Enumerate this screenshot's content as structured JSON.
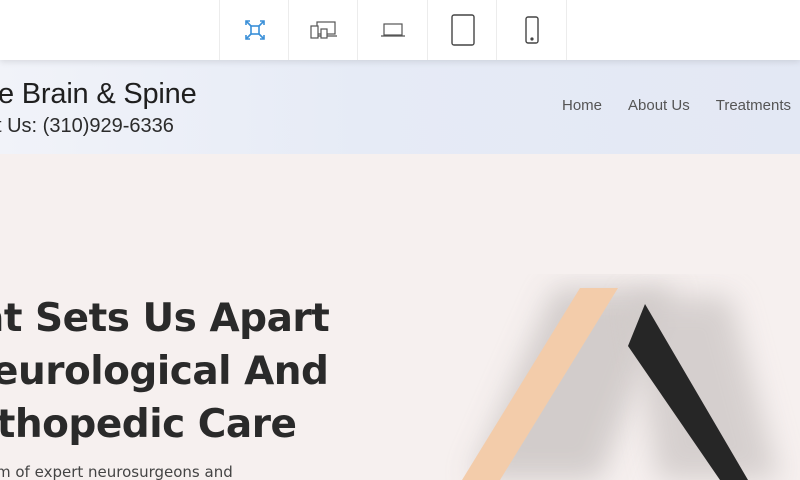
{
  "toolbar": {
    "devices": [
      {
        "name": "fullscreen",
        "icon": "expand-arrows-icon",
        "active": true
      },
      {
        "name": "all-devices",
        "icon": "multi-device-icon",
        "active": false
      },
      {
        "name": "laptop",
        "icon": "laptop-icon",
        "active": false
      },
      {
        "name": "tablet",
        "icon": "tablet-icon",
        "active": false
      },
      {
        "name": "mobile",
        "icon": "mobile-icon",
        "active": false
      }
    ],
    "accent_color": "#3a8fd8"
  },
  "header": {
    "brand": "e Brain & Spine",
    "phone": "t Us: (310)929-6336",
    "nav": [
      "Home",
      "About Us",
      "Treatments"
    ]
  },
  "hero": {
    "title_lines": [
      "at Sets Us Apart",
      "Jeurological And",
      "rthopedic Care"
    ],
    "text": "m of expert neurosurgeons and",
    "colors": {
      "background": "#f6f0ef",
      "peach": "#f3ccaa",
      "dark": "#262626"
    }
  }
}
